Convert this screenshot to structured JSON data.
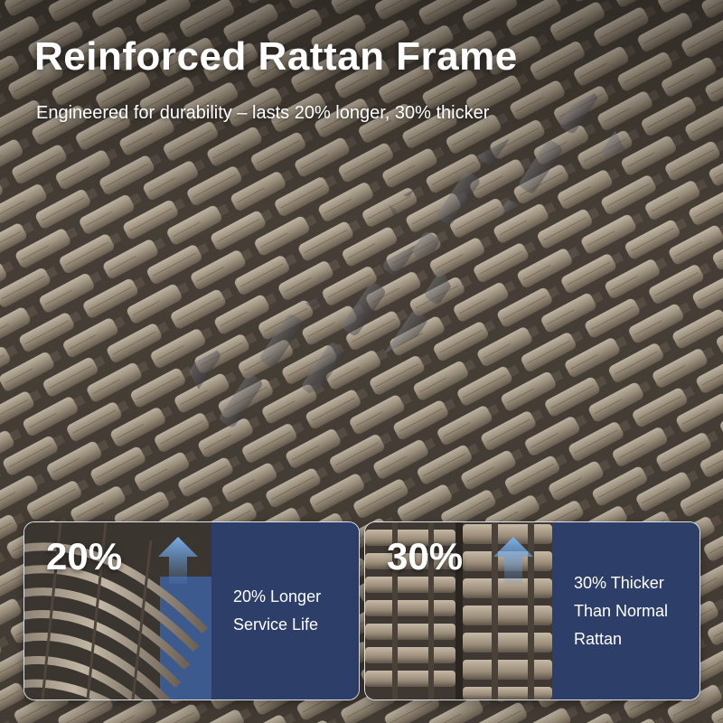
{
  "header": {
    "title": "Reinforced Rattan Frame",
    "subtitle": "Engineered for durability – lasts 20% longer, 30% thicker"
  },
  "features": [
    {
      "percent": "20%",
      "line1": "20% Longer",
      "line2": "Service Life",
      "icon": "up-arrow-icon"
    },
    {
      "percent": "30%",
      "line1": "30% Thicker",
      "line2": "Than Normal",
      "line3": "Rattan",
      "icon": "up-arrow-icon"
    }
  ],
  "colors": {
    "panel": "#2d3f68",
    "arrow": "#5c8fd0",
    "strand_light": "#a89c8c",
    "strand_dark": "#5a544e",
    "binder": "#4a4239"
  }
}
